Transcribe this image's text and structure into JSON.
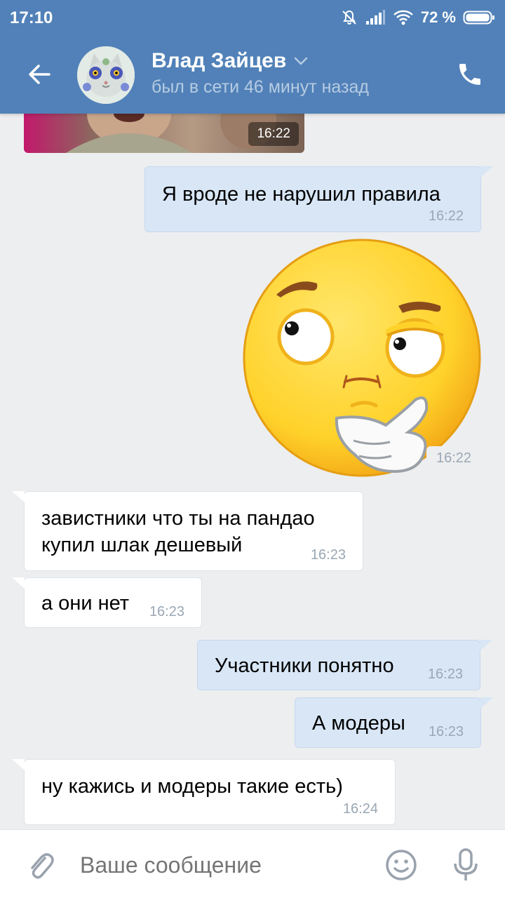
{
  "status_bar": {
    "time": "17:10",
    "battery": "72 %"
  },
  "header": {
    "name": "Влад Зайцев",
    "status": "был в сети 46 минут назад"
  },
  "messages": [
    {
      "type": "photo",
      "time": "16:22"
    },
    {
      "type": "out",
      "text": "Я вроде не нарушил правила",
      "time": "16:22"
    },
    {
      "type": "sticker",
      "time": "16:22"
    },
    {
      "type": "in",
      "text": "завистники что ты на пандао купил шлак дешевый",
      "line1": "завистники что ты на пандао",
      "line2": "купил шлак дешевый",
      "time": "16:23"
    },
    {
      "type": "in",
      "text": "а они нет",
      "time": "16:23"
    },
    {
      "type": "out",
      "text": "Участники понятно",
      "time": "16:23"
    },
    {
      "type": "out",
      "text": "А модеры",
      "time": "16:23"
    },
    {
      "type": "in",
      "text": "ну кажись и модеры такие есть)",
      "time": "16:24"
    }
  ],
  "input": {
    "placeholder": "Ваше сообщение"
  },
  "colors": {
    "header": "#5181b8",
    "outgoing": "#d8e6f6",
    "incoming": "#ffffff",
    "background": "#edeef0"
  }
}
